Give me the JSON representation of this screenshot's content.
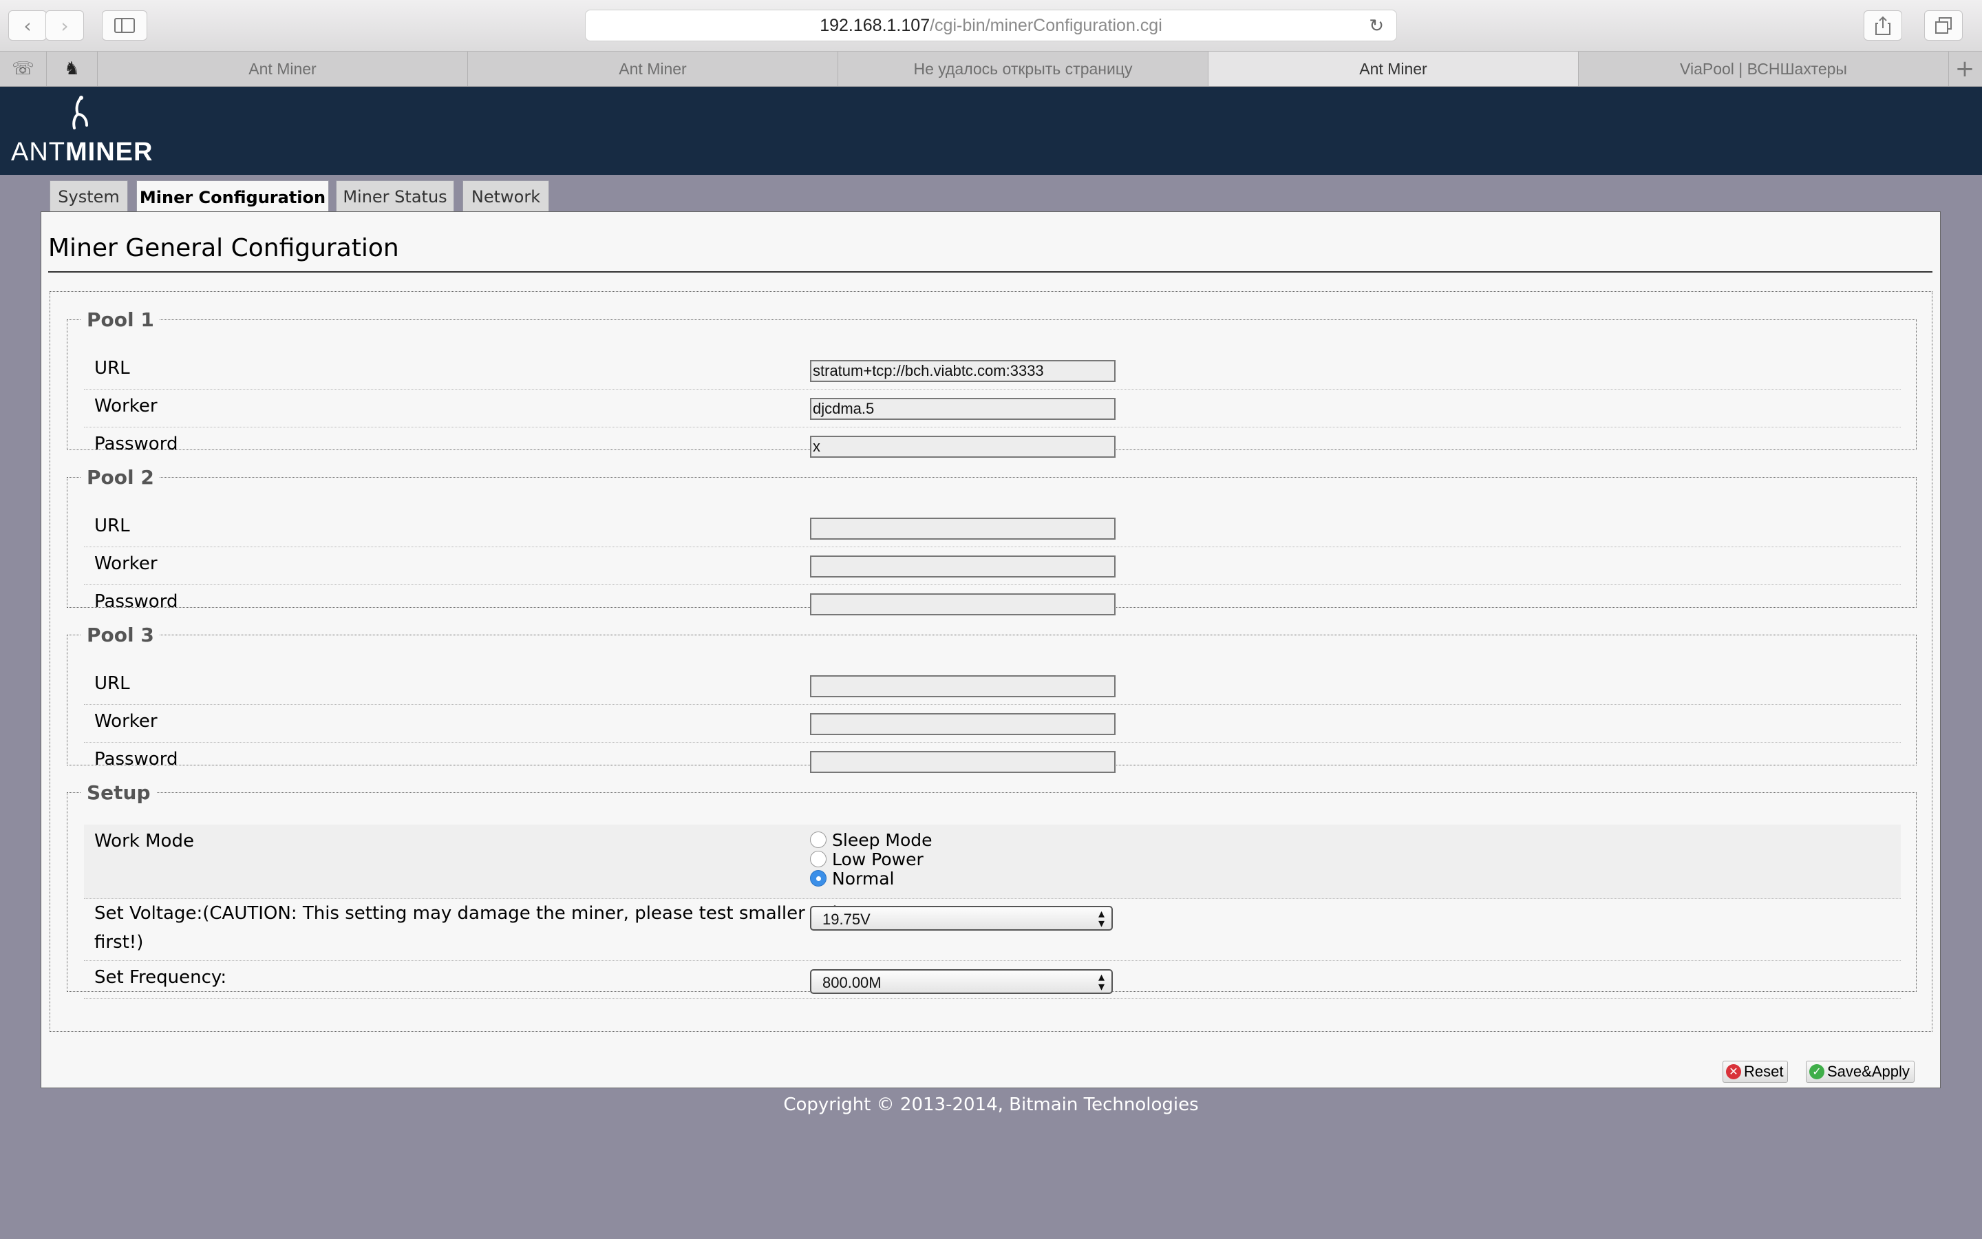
{
  "browser": {
    "url_host": "192.168.1.107",
    "url_path": "/cgi-bin/minerConfiguration.cgi",
    "tabs": [
      {
        "label": "Ant Miner"
      },
      {
        "label": "Ant Miner"
      },
      {
        "label": "Не удалось открыть страницу"
      },
      {
        "label": "Ant Miner"
      },
      {
        "label": "ViaPool | ВСНШахтеры"
      }
    ]
  },
  "brand": {
    "logo_light": "ANT",
    "logo_bold": "MINER"
  },
  "nav_tabs": [
    {
      "label": "System"
    },
    {
      "label": "Miner Configuration"
    },
    {
      "label": "Miner Status"
    },
    {
      "label": "Network"
    }
  ],
  "page_title": "Miner General Configuration",
  "pools": [
    {
      "legend": "Pool 1",
      "url_label": "URL",
      "worker_label": "Worker",
      "password_label": "Password",
      "url": "stratum+tcp://bch.viabtc.com:3333",
      "worker": "djcdma.5",
      "password": "x"
    },
    {
      "legend": "Pool 2",
      "url_label": "URL",
      "worker_label": "Worker",
      "password_label": "Password",
      "url": "",
      "worker": "",
      "password": ""
    },
    {
      "legend": "Pool 3",
      "url_label": "URL",
      "worker_label": "Worker",
      "password_label": "Password",
      "url": "",
      "worker": "",
      "password": ""
    }
  ],
  "setup": {
    "legend": "Setup",
    "work_mode_label": "Work Mode",
    "work_modes": [
      {
        "label": "Sleep Mode",
        "selected": false
      },
      {
        "label": "Low Power",
        "selected": false
      },
      {
        "label": "Normal",
        "selected": true
      }
    ],
    "voltage_label": "Set Voltage:(CAUTION: This setting may damage the miner, please test smaller value",
    "voltage_label_cont": "first!)",
    "voltage_value": "19.75V",
    "frequency_label": "Set Frequency:",
    "frequency_value": "800.00M"
  },
  "buttons": {
    "reset": "Reset",
    "save_apply": "Save&Apply"
  },
  "footer": "Copyright © 2013-2014, Bitmain Technologies",
  "colors": {
    "header_bg": "#172b43",
    "page_bg": "#8e8c9e",
    "radio_selected": "#3b8fe8"
  }
}
